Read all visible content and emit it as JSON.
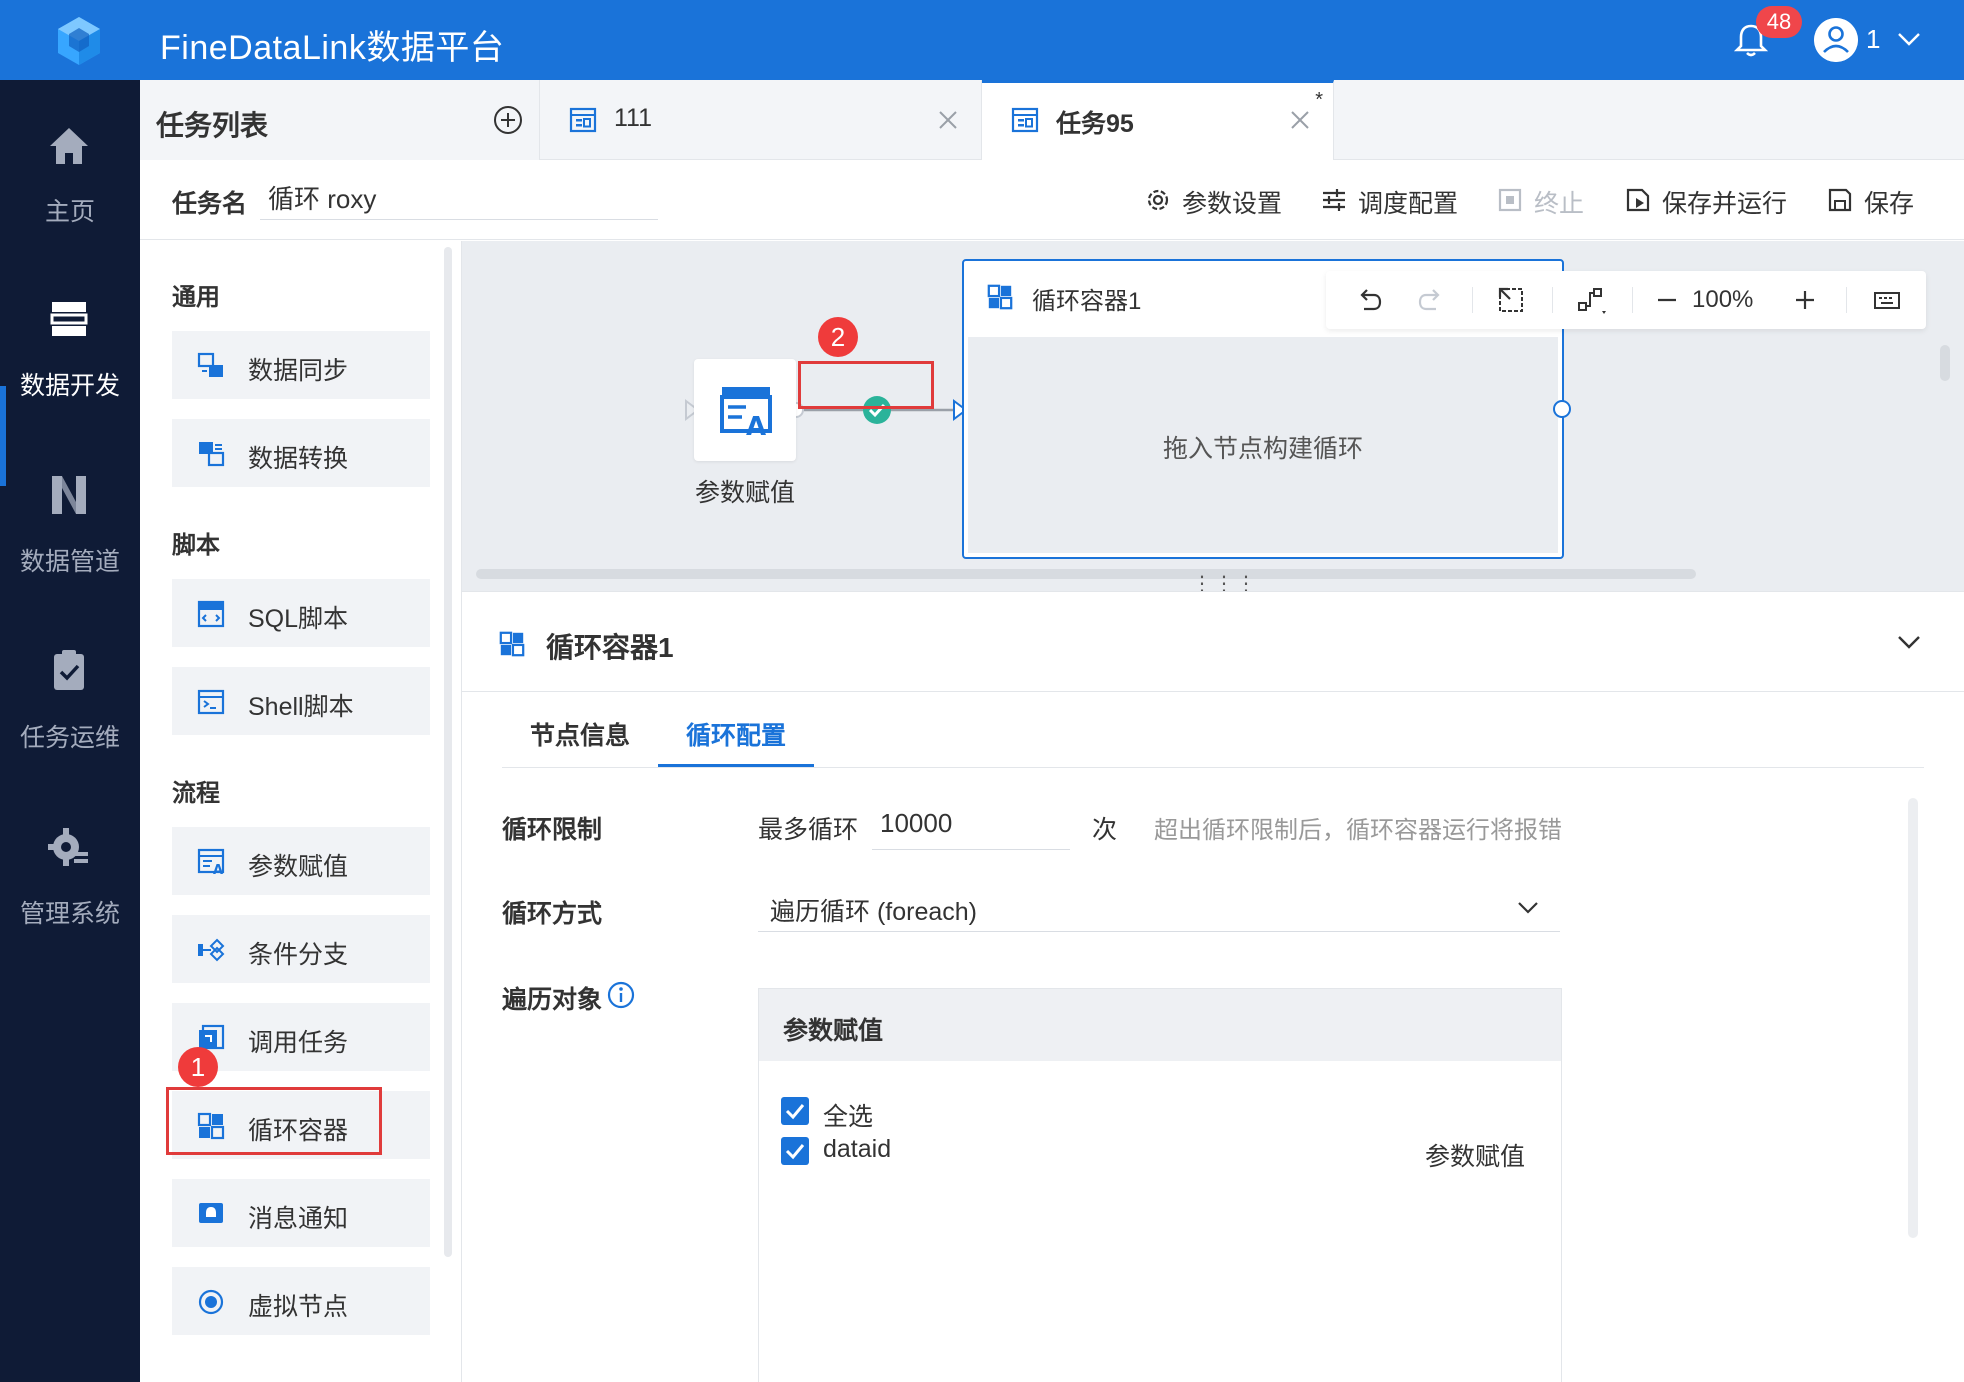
{
  "app": {
    "title": "FineDataLink数据平台",
    "notification_count": "48",
    "user_name": "1"
  },
  "nav": [
    {
      "label": "主页"
    },
    {
      "label": "数据开发"
    },
    {
      "label": "数据管道"
    },
    {
      "label": "任务运维"
    },
    {
      "label": "管理系统"
    }
  ],
  "tasklist": {
    "title": "任务列表"
  },
  "tabs": [
    {
      "label": "111"
    },
    {
      "label": "任务95",
      "modified_mark": "*"
    }
  ],
  "task": {
    "name_label": "任务名",
    "name_value": "循环 roxy"
  },
  "toolbar": {
    "params": "参数设置",
    "schedule": "调度配置",
    "stop": "终止",
    "save_run": "保存并运行",
    "save": "保存"
  },
  "nodepanel": {
    "sections": [
      {
        "title": "通用",
        "items": [
          "数据同步",
          "数据转换"
        ]
      },
      {
        "title": "脚本",
        "items": [
          "SQL脚本",
          "Shell脚本"
        ]
      },
      {
        "title": "流程",
        "items": [
          "参数赋值",
          "条件分支",
          "调用任务",
          "循环容器",
          "消息通知",
          "虚拟节点"
        ]
      }
    ]
  },
  "canvas": {
    "node_label": "参数赋值",
    "container_title": "循环容器1",
    "container_hint": "拖入节点构建循环",
    "zoom": "100%"
  },
  "callouts": [
    "1",
    "2"
  ],
  "props": {
    "title": "循环容器1",
    "tabs": [
      "节点信息",
      "循环配置"
    ],
    "loop_limit_label": "循环限制",
    "max_label": "最多循环",
    "max_value": "10000",
    "times_label": "次",
    "limit_hint": "超出循环限制后，循环容器运行将报错",
    "method_label": "循环方式",
    "method_value": "遍历循环 (foreach)",
    "object_label": "遍历对象",
    "object_panel_title": "参数赋值",
    "select_all": "全选",
    "param_name": "dataid",
    "param_source": "参数赋值"
  },
  "colors": {
    "primary": "#1a73d9",
    "nav_bg": "#0f1b36",
    "callout": "#ef3b3b",
    "success": "#2bb39a"
  }
}
